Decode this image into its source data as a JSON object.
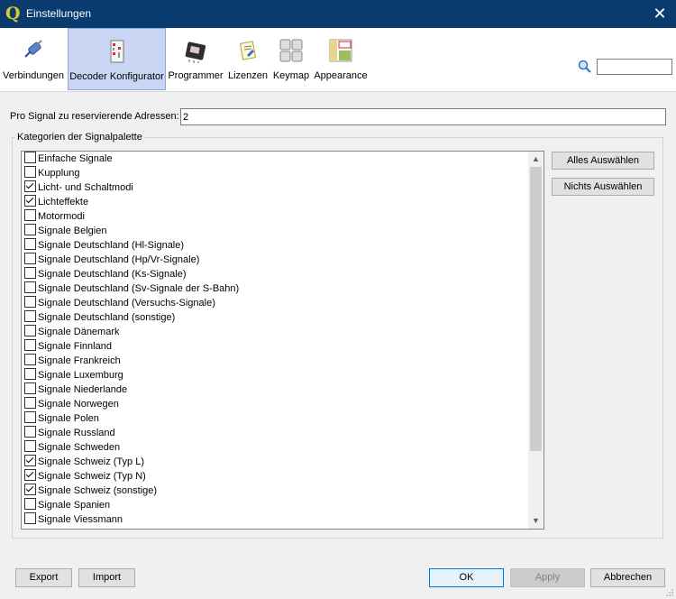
{
  "window": {
    "title": "Einstellungen",
    "app_icon": "Q"
  },
  "toolbar": {
    "items": [
      {
        "label": "Verbindungen",
        "icon": "plug-icon"
      },
      {
        "label": "Decoder Konfigurator",
        "icon": "decoder-icon",
        "selected": true
      },
      {
        "label": "Programmer",
        "icon": "chip-icon"
      },
      {
        "label": "Lizenzen",
        "icon": "certificate-icon"
      },
      {
        "label": "Keymap",
        "icon": "keyboard-icon"
      },
      {
        "label": "Appearance",
        "icon": "layout-icon"
      }
    ],
    "search": {
      "value": ""
    }
  },
  "form": {
    "address_label": "Pro Signal zu reservierende Adressen:",
    "address_value": "2",
    "group_title": "Kategorien der Signalpalette"
  },
  "categories": [
    {
      "label": "Einfache Signale",
      "checked": false
    },
    {
      "label": "Kupplung",
      "checked": false
    },
    {
      "label": "Licht- und Schaltmodi",
      "checked": true
    },
    {
      "label": "Lichteffekte",
      "checked": true
    },
    {
      "label": "Motormodi",
      "checked": false
    },
    {
      "label": "Signale Belgien",
      "checked": false
    },
    {
      "label": "Signale Deutschland (Hl-Signale)",
      "checked": false
    },
    {
      "label": "Signale Deutschland (Hp/Vr-Signale)",
      "checked": false
    },
    {
      "label": "Signale Deutschland (Ks-Signale)",
      "checked": false
    },
    {
      "label": "Signale Deutschland (Sv-Signale der S-Bahn)",
      "checked": false
    },
    {
      "label": "Signale Deutschland (Versuchs-Signale)",
      "checked": false
    },
    {
      "label": "Signale Deutschland (sonstige)",
      "checked": false
    },
    {
      "label": "Signale Dänemark",
      "checked": false
    },
    {
      "label": "Signale Finnland",
      "checked": false
    },
    {
      "label": "Signale Frankreich",
      "checked": false
    },
    {
      "label": "Signale Luxemburg",
      "checked": false
    },
    {
      "label": "Signale Niederlande",
      "checked": false
    },
    {
      "label": "Signale Norwegen",
      "checked": false
    },
    {
      "label": "Signale Polen",
      "checked": false
    },
    {
      "label": "Signale Russland",
      "checked": false
    },
    {
      "label": "Signale Schweden",
      "checked": false
    },
    {
      "label": "Signale Schweiz (Typ L)",
      "checked": true
    },
    {
      "label": "Signale Schweiz (Typ N)",
      "checked": true
    },
    {
      "label": "Signale Schweiz (sonstige)",
      "checked": true
    },
    {
      "label": "Signale Spanien",
      "checked": false
    },
    {
      "label": "Signale Viessmann",
      "checked": false
    }
  ],
  "side_buttons": {
    "select_all": "Alles Auswählen",
    "select_none": "Nichts Auswählen"
  },
  "footer": {
    "export": "Export",
    "import": "Import",
    "ok": "OK",
    "apply": "Apply",
    "cancel": "Abbrechen"
  },
  "colors": {
    "titlebar": "#0a3b6e",
    "selected_tab": "#c8d6f4",
    "primary_border": "#0078d7"
  }
}
